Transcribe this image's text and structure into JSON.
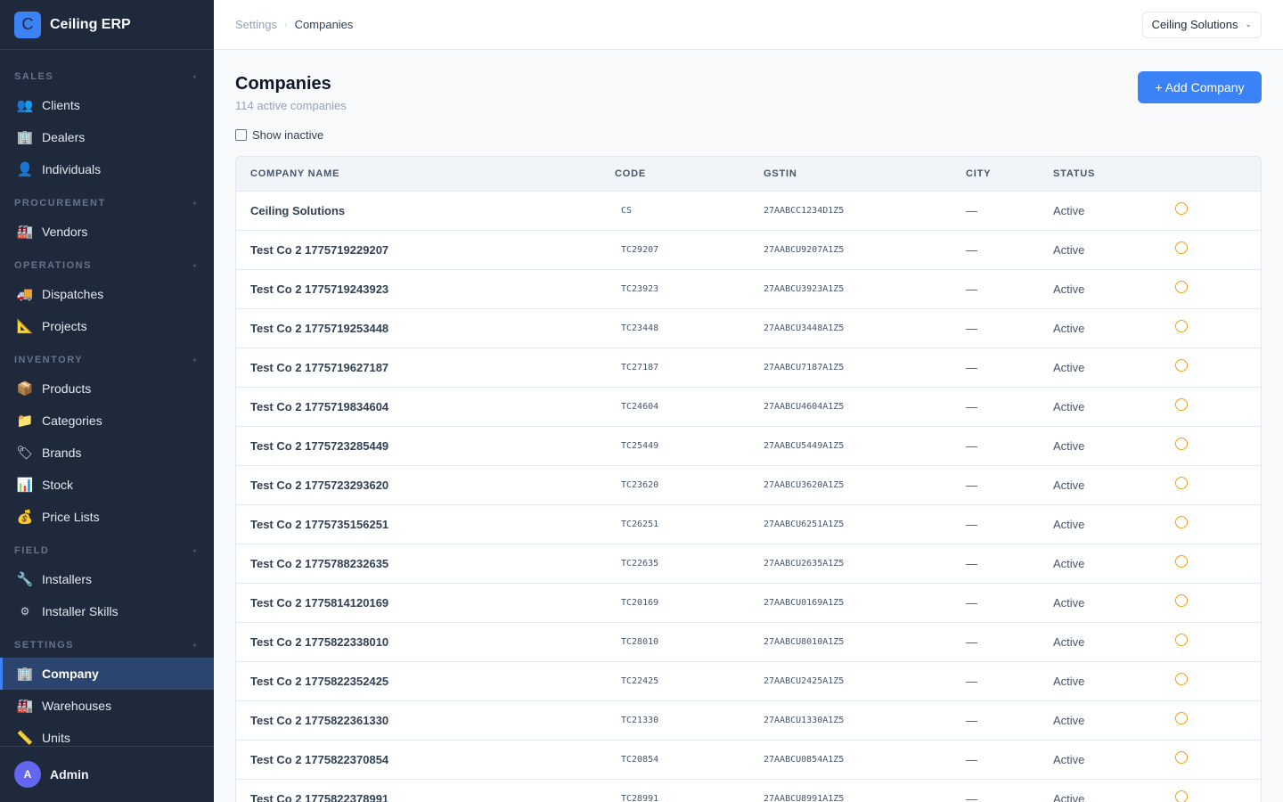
{
  "brand": {
    "logo_letter": "C",
    "name": "Ceiling ERP"
  },
  "sidebar": {
    "sections": [
      {
        "title": "SALES",
        "items": [
          {
            "icon": "👥",
            "icon_name": "people-icon",
            "label": "Clients"
          },
          {
            "icon": "🏢",
            "icon_name": "building-icon",
            "label": "Dealers"
          },
          {
            "icon": "👤",
            "icon_name": "person-icon",
            "label": "Individuals"
          }
        ]
      },
      {
        "title": "PROCUREMENT",
        "items": [
          {
            "icon": "🏭",
            "icon_name": "factory-icon",
            "label": "Vendors"
          }
        ]
      },
      {
        "title": "OPERATIONS",
        "items": [
          {
            "icon": "🚚",
            "icon_name": "truck-icon",
            "label": "Dispatches"
          },
          {
            "icon": "📐",
            "icon_name": "ruler-triangle-icon",
            "label": "Projects"
          }
        ]
      },
      {
        "title": "INVENTORY",
        "items": [
          {
            "icon": "📦",
            "icon_name": "package-icon",
            "label": "Products"
          },
          {
            "icon": "📁",
            "icon_name": "folder-icon",
            "label": "Categories"
          },
          {
            "icon": "🏷",
            "icon_name": "tag-icon",
            "label": "Brands"
          },
          {
            "icon": "📊",
            "icon_name": "bar-chart-icon",
            "label": "Stock"
          },
          {
            "icon": "💰",
            "icon_name": "money-bag-icon",
            "label": "Price Lists"
          }
        ]
      },
      {
        "title": "FIELD",
        "items": [
          {
            "icon": "🔧",
            "icon_name": "wrench-icon",
            "label": "Installers"
          },
          {
            "icon": "⚙",
            "icon_name": "gear-icon",
            "label": "Installer Skills"
          }
        ]
      },
      {
        "title": "SETTINGS",
        "items": [
          {
            "icon": "🏢",
            "icon_name": "building-icon",
            "label": "Company",
            "active": true
          },
          {
            "icon": "🏭",
            "icon_name": "factory-icon",
            "label": "Warehouses"
          },
          {
            "icon": "📏",
            "icon_name": "ruler-icon",
            "label": "Units"
          }
        ]
      }
    ],
    "user": {
      "initial": "A",
      "name": "Admin"
    }
  },
  "header": {
    "breadcrumb": [
      "Settings",
      "Companies"
    ],
    "company_selector": "Ceiling Solutions"
  },
  "page": {
    "title": "Companies",
    "subtitle": "114 active companies",
    "add_button": "+ Add Company",
    "show_inactive_label": "Show inactive",
    "show_inactive_checked": false
  },
  "table": {
    "columns": [
      "COMPANY NAME",
      "CODE",
      "GSTIN",
      "CITY",
      "STATUS"
    ],
    "rows": [
      {
        "name": "Ceiling Solutions",
        "code": "CS",
        "gstin": "27AABCC1234D1Z5",
        "city": "—",
        "status": "Active"
      },
      {
        "name": "Test Co 2 1775719229207",
        "code": "TC29207",
        "gstin": "27AABCU9207A1Z5",
        "city": "—",
        "status": "Active"
      },
      {
        "name": "Test Co 2 1775719243923",
        "code": "TC23923",
        "gstin": "27AABCU3923A1Z5",
        "city": "—",
        "status": "Active"
      },
      {
        "name": "Test Co 2 1775719253448",
        "code": "TC23448",
        "gstin": "27AABCU3448A1Z5",
        "city": "—",
        "status": "Active"
      },
      {
        "name": "Test Co 2 1775719627187",
        "code": "TC27187",
        "gstin": "27AABCU7187A1Z5",
        "city": "—",
        "status": "Active"
      },
      {
        "name": "Test Co 2 1775719834604",
        "code": "TC24604",
        "gstin": "27AABCU4604A1Z5",
        "city": "—",
        "status": "Active"
      },
      {
        "name": "Test Co 2 1775723285449",
        "code": "TC25449",
        "gstin": "27AABCU5449A1Z5",
        "city": "—",
        "status": "Active"
      },
      {
        "name": "Test Co 2 1775723293620",
        "code": "TC23620",
        "gstin": "27AABCU3620A1Z5",
        "city": "—",
        "status": "Active"
      },
      {
        "name": "Test Co 2 1775735156251",
        "code": "TC26251",
        "gstin": "27AABCU6251A1Z5",
        "city": "—",
        "status": "Active"
      },
      {
        "name": "Test Co 2 1775788232635",
        "code": "TC22635",
        "gstin": "27AABCU2635A1Z5",
        "city": "—",
        "status": "Active"
      },
      {
        "name": "Test Co 2 1775814120169",
        "code": "TC20169",
        "gstin": "27AABCU0169A1Z5",
        "city": "—",
        "status": "Active"
      },
      {
        "name": "Test Co 2 1775822338010",
        "code": "TC28010",
        "gstin": "27AABCU8010A1Z5",
        "city": "—",
        "status": "Active"
      },
      {
        "name": "Test Co 2 1775822352425",
        "code": "TC22425",
        "gstin": "27AABCU2425A1Z5",
        "city": "—",
        "status": "Active"
      },
      {
        "name": "Test Co 2 1775822361330",
        "code": "TC21330",
        "gstin": "27AABCU1330A1Z5",
        "city": "—",
        "status": "Active"
      },
      {
        "name": "Test Co 2 1775822370854",
        "code": "TC20854",
        "gstin": "27AABCU0854A1Z5",
        "city": "—",
        "status": "Active"
      },
      {
        "name": "Test Co 2 1775822378991",
        "code": "TC28991",
        "gstin": "27AABCU8991A1Z5",
        "city": "—",
        "status": "Active"
      }
    ]
  },
  "colors": {
    "sidebar_bg": "#1e293b",
    "accent": "#3b82f6",
    "status_ring": "#f59e0b"
  }
}
